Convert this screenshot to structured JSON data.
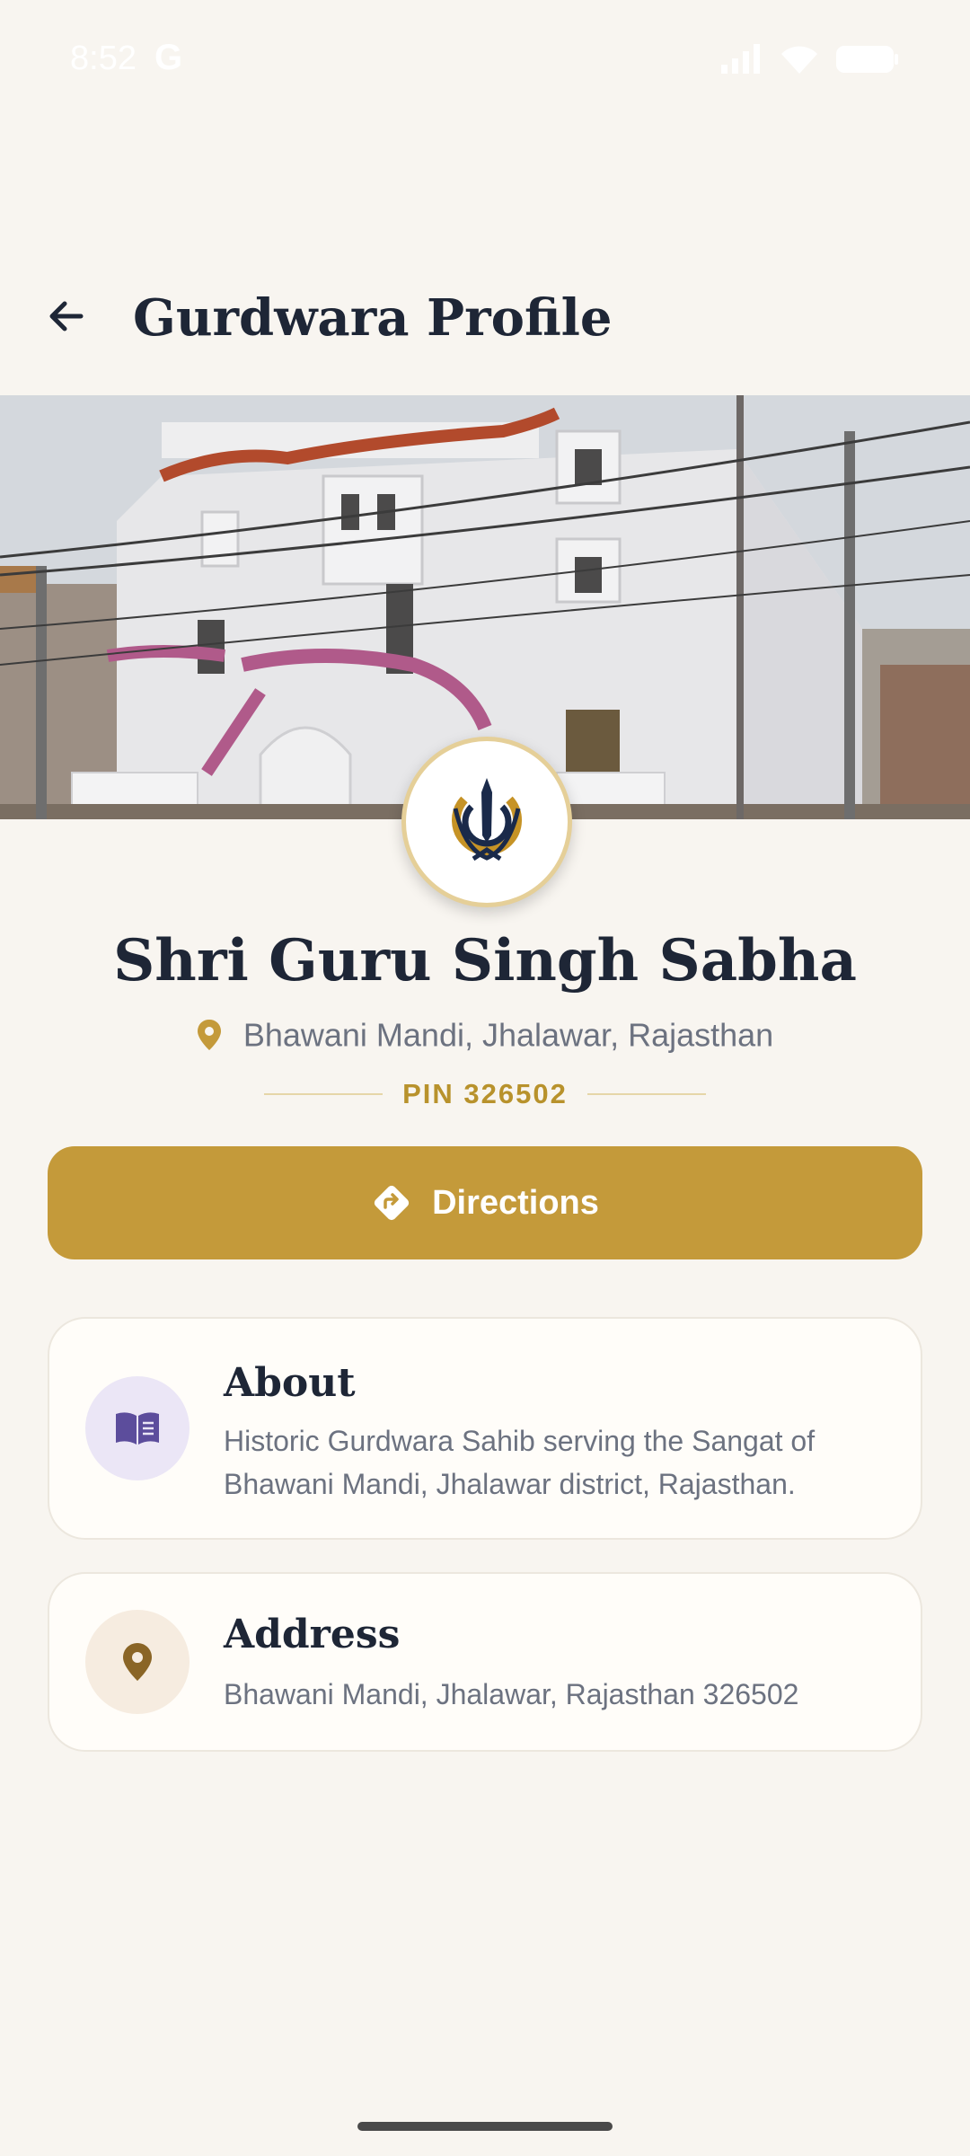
{
  "status_bar": {
    "time": "8:52",
    "carrier_glyph": "G",
    "icons": [
      "signal-icon",
      "wifi-icon",
      "battery-icon"
    ]
  },
  "app_bar": {
    "back_icon": "arrow-left-icon",
    "title": "Gurdwara Profile"
  },
  "hero": {
    "image": "gurdwara-building-photo"
  },
  "profile": {
    "emblem_icon": "khanda-emblem-icon",
    "name": "Shri Guru Singh Sabha",
    "location": "Bhawani Mandi, Jhalawar, Rajasthan",
    "pin": "PIN 326502"
  },
  "actions": {
    "directions_label": "Directions"
  },
  "cards": {
    "about": {
      "icon": "book-icon",
      "title": "About",
      "text": "Historic Gurdwara Sahib serving the Sangat of Bhawani Mandi, Jhalawar district, Rajasthan."
    },
    "address": {
      "icon": "location-pin-icon",
      "title": "Address",
      "text": "Bhawani Mandi, Jhalawar, Rajasthan 326502"
    }
  },
  "colors": {
    "background": "#f8f5f0",
    "accent_gold": "#c49a3a",
    "title_text": "#1e2636",
    "muted_text": "#6c7280",
    "about_icon_bg": "#ebe6f6",
    "address_icon_bg": "#f6ece0"
  }
}
